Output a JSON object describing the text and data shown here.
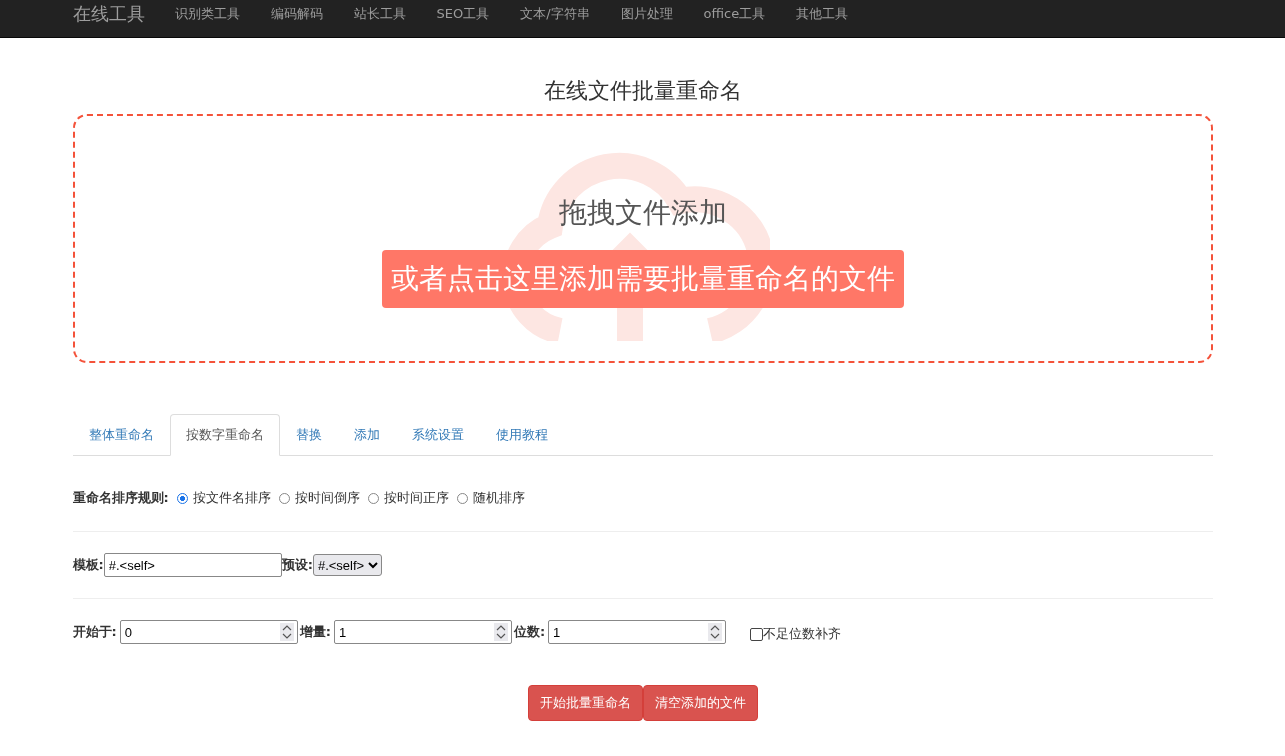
{
  "navbar": {
    "brand": "在线工具",
    "items": [
      "识别类工具",
      "编码解码",
      "站长工具",
      "SEO工具",
      "文本/字符串",
      "图片处理",
      "office工具",
      "其他工具"
    ]
  },
  "page_title": "在线文件批量重命名",
  "dropzone": {
    "heading": "拖拽文件添加",
    "button": "或者点击这里添加需要批量重命名的文件"
  },
  "tabs": [
    {
      "label": "整体重命名",
      "selected": false
    },
    {
      "label": "按数字重命名",
      "selected": true
    },
    {
      "label": "替换",
      "selected": false
    },
    {
      "label": "添加",
      "selected": false
    },
    {
      "label": "系统设置",
      "selected": false
    },
    {
      "label": "使用教程",
      "selected": false
    }
  ],
  "sort_rule": {
    "label": "重命名排序规则:",
    "options": [
      {
        "label": "按文件名排序",
        "selected": true
      },
      {
        "label": "按时间倒序",
        "selected": false
      },
      {
        "label": "按时间正序",
        "selected": false
      },
      {
        "label": "随机排序",
        "selected": false
      }
    ]
  },
  "template": {
    "label": "模板:",
    "value": "#.<self>",
    "preset_label": "预设:",
    "preset_value": "#.<self>"
  },
  "numbers": [
    {
      "label": "开始于:",
      "value": "0"
    },
    {
      "label": "增量:",
      "value": "1"
    },
    {
      "label": "位数:",
      "value": "1"
    }
  ],
  "pad": {
    "label": "不足位数补齐",
    "checked": false
  },
  "buttons": [
    "开始批量重命名",
    "清空添加的文件"
  ]
}
